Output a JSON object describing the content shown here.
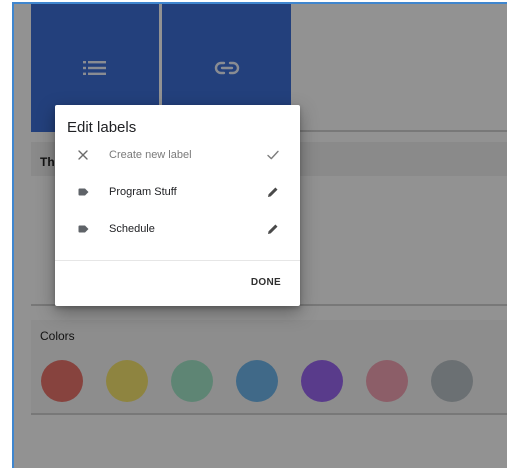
{
  "dialog": {
    "title": "Edit labels",
    "create_placeholder": "Create new label",
    "labels": [
      "Program Stuff",
      "Schedule"
    ],
    "done_label": "DONE"
  },
  "cards": {
    "first_header": "Thi",
    "colors_header": "Colors"
  },
  "tiles": {
    "icons": [
      "list-icon",
      "link-icon"
    ],
    "color": "#3d6fd6"
  },
  "colors": {
    "swatches": [
      "#e8746c",
      "#f4e36f",
      "#a3e6c9",
      "#6fb6ea",
      "#9a66f0",
      "#f1a3b3",
      "#b9c1c6"
    ]
  },
  "theme": {
    "frame_border": "#3f86cf"
  }
}
